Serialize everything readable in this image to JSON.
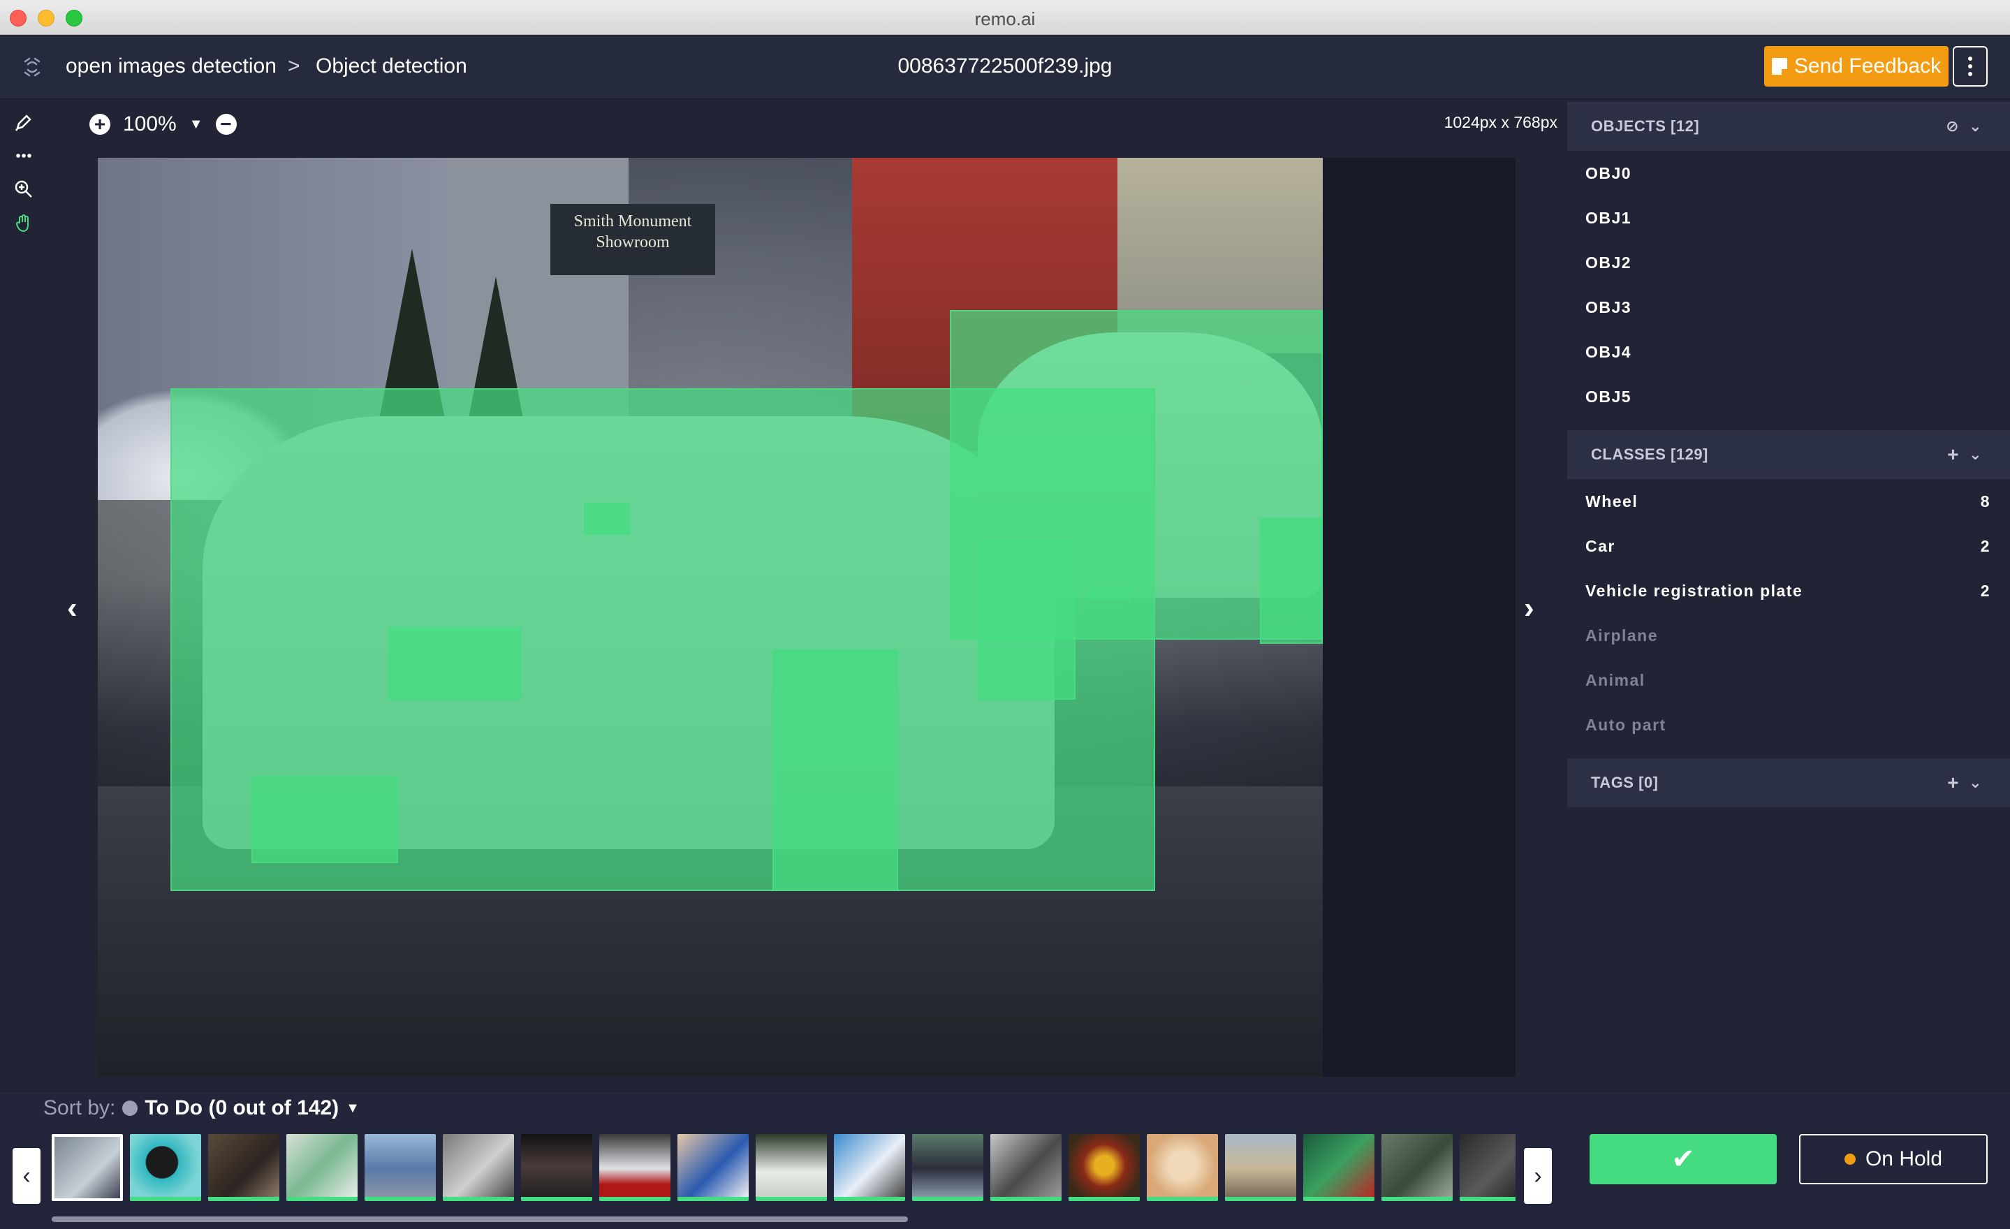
{
  "window": {
    "title": "remo.ai"
  },
  "header": {
    "breadcrumb": [
      "open images detection",
      "Object detection"
    ],
    "breadcrumb_separator": ">",
    "filename": "008637722500f239.jpg",
    "feedback_label": "Send Feedback",
    "accent_color": "#f39c12"
  },
  "toolbar": {
    "tools": [
      "pen-icon",
      "more-icon",
      "zoom-in-icon",
      "hand-icon"
    ]
  },
  "canvas": {
    "zoom": "100%",
    "dimensions": "1024px x 768px",
    "box_color": "#46dc82"
  },
  "panel": {
    "objects_header": "OBJECTS [12]",
    "objects": [
      "OBJ0",
      "OBJ1",
      "OBJ2",
      "OBJ3",
      "OBJ4",
      "OBJ5"
    ],
    "classes_header": "CLASSES [129]",
    "classes": [
      {
        "name": "Wheel",
        "count": "8"
      },
      {
        "name": "Car",
        "count": "2"
      },
      {
        "name": "Vehicle registration plate",
        "count": "2"
      },
      {
        "name": "Airplane",
        "count": ""
      },
      {
        "name": "Animal",
        "count": ""
      },
      {
        "name": "Auto part",
        "count": ""
      }
    ],
    "tags_header": "TAGS [0]"
  },
  "bottom": {
    "sort_label": "Sort by:",
    "sort_value": "To Do (0 out of 142)",
    "approve_icon": "check-icon",
    "on_hold_label": "On Hold",
    "thumbnails_count": 19
  }
}
